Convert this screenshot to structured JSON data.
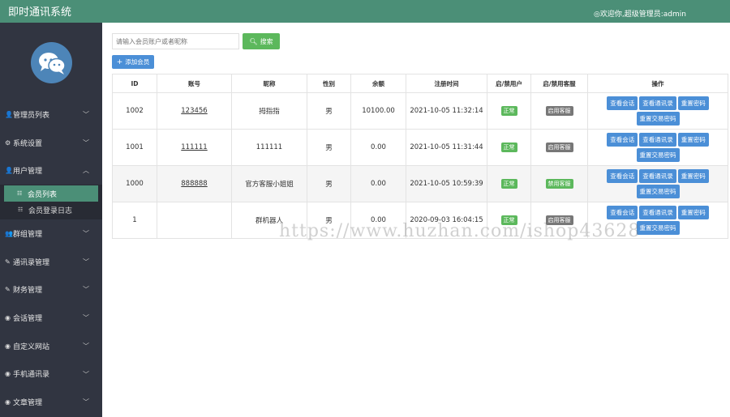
{
  "header": {
    "title": "即时通讯系统",
    "welcome": "◎欢迎你,超级管理员:admin"
  },
  "sidebar": {
    "items": [
      {
        "label": "管理员列表",
        "icon": "user-icon",
        "glyph": "👤"
      },
      {
        "label": "系统设置",
        "icon": "gear-icon",
        "glyph": "⚙"
      },
      {
        "label": "用户管理",
        "icon": "user-icon",
        "glyph": "👤"
      },
      {
        "label": "群组管理",
        "icon": "users-icon",
        "glyph": "👥"
      },
      {
        "label": "通讯录管理",
        "icon": "edit-icon",
        "glyph": "✎"
      },
      {
        "label": "财务管理",
        "icon": "edit-icon",
        "glyph": "✎"
      },
      {
        "label": "会话管理",
        "icon": "circle-icon",
        "glyph": "◉"
      },
      {
        "label": "自定义网站",
        "icon": "circle-icon",
        "glyph": "◉"
      },
      {
        "label": "手机通讯录",
        "icon": "circle-icon",
        "glyph": "◉"
      },
      {
        "label": "文章管理",
        "icon": "circle-icon",
        "glyph": "◉"
      }
    ],
    "sub_items": [
      {
        "label": "会员列表",
        "active": true
      },
      {
        "label": "会员登录日志",
        "active": false
      }
    ]
  },
  "search": {
    "placeholder": "请输入会员账户或者昵称",
    "button_label": "搜索"
  },
  "add_button_label": "添加会员",
  "table": {
    "headers": [
      "ID",
      "账号",
      "昵称",
      "性别",
      "余额",
      "注册时间",
      "启/禁用户",
      "启/禁用客服",
      "操作"
    ],
    "rows": [
      {
        "id": "1002",
        "account": "123456",
        "nickname": "拇指指",
        "gender": "男",
        "balance": "10100.00",
        "registered": "2021-10-05 11:32:14",
        "user_status": "正常",
        "service_status": "启用客服"
      },
      {
        "id": "1001",
        "account": "111111",
        "nickname": "111111",
        "gender": "男",
        "balance": "0.00",
        "registered": "2021-10-05 11:31:44",
        "user_status": "正常",
        "service_status": "启用客服"
      },
      {
        "id": "1000",
        "account": "888888",
        "nickname": "官方客服小姐姐",
        "gender": "男",
        "balance": "0.00",
        "registered": "2021-10-05 10:59:39",
        "user_status": "正常",
        "service_status": "禁用客服"
      },
      {
        "id": "1",
        "account": "",
        "nickname": "群机器人",
        "gender": "男",
        "balance": "0.00",
        "registered": "2020-09-03 16:04:15",
        "user_status": "正常",
        "service_status": "启用客服"
      }
    ],
    "ops": {
      "view_chat": "查看会话",
      "view_contacts": "查看通讯录",
      "reset_password": "重置密码",
      "reset_trade_password": "重置交易密码"
    }
  },
  "colors": {
    "header_bg": "#4b8f77",
    "sidebar_bg": "#313541",
    "primary": "#4b8fd7",
    "success": "#5cb85c",
    "muted": "#777777"
  },
  "watermark": "https://www.huzhan.com/ishop43628"
}
